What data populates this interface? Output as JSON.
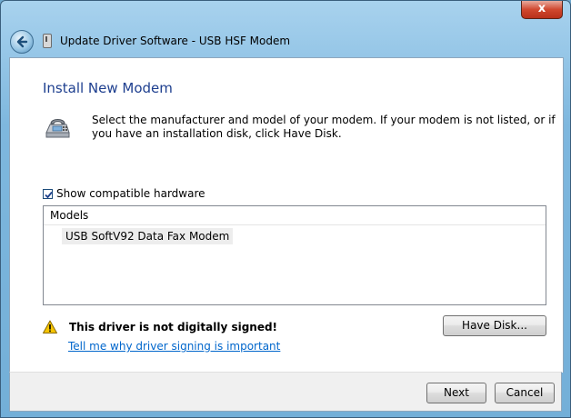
{
  "window": {
    "title": "Update Driver Software - USB HSF Modem",
    "close_label": "x"
  },
  "icons": {
    "back": "back-arrow-icon",
    "title": "modem-device-icon",
    "modem": "telephone-modem-icon",
    "warning": "warning-triangle-icon",
    "checkbox": "checkmark-icon"
  },
  "main": {
    "heading": "Install New Modem",
    "description": "Select the manufacturer and model of your modem. If your modem is not listed, or if you have an installation disk, click Have Disk.",
    "show_compatible": {
      "label": "Show compatible hardware",
      "checked": true
    },
    "models": {
      "header": "Models",
      "items": [
        "USB SoftV92 Data Fax Modem"
      ]
    },
    "warning": {
      "text": "This driver is not digitally signed!",
      "link": "Tell me why driver signing is important"
    },
    "have_disk_label": "Have Disk..."
  },
  "footer": {
    "next_label": "Next",
    "cancel_label": "Cancel"
  },
  "colors": {
    "heading": "#1e3f8f",
    "link": "#0066cc",
    "warning": "#f5c400"
  }
}
